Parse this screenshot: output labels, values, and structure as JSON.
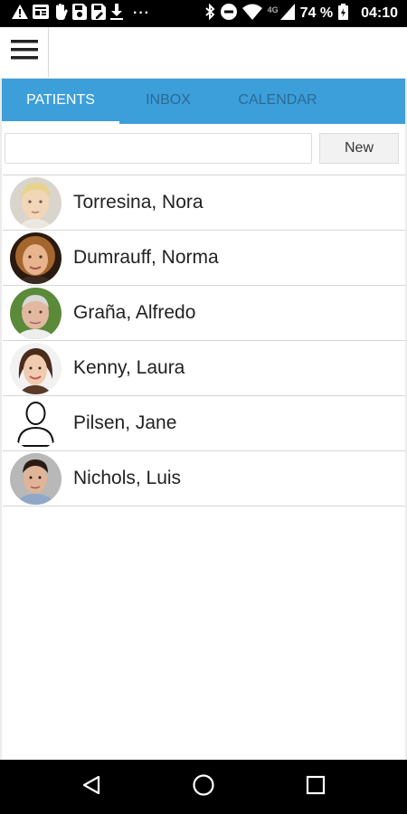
{
  "status_bar": {
    "battery_percent": "74 %",
    "time": "04:10",
    "network": "4G",
    "overflow": "···",
    "left_icons": [
      "alert-icon",
      "news-icon",
      "hand-icon",
      "save-icon",
      "save-edit-icon",
      "download-icon"
    ],
    "right_icons": [
      "bluetooth-icon",
      "do-not-disturb-icon",
      "wifi-icon",
      "signal-icon",
      "battery-icon"
    ]
  },
  "tabs": [
    {
      "label": "PATIENTS",
      "active": true
    },
    {
      "label": "INBOX",
      "active": false
    },
    {
      "label": "CALENDAR",
      "active": false
    }
  ],
  "search": {
    "value": "",
    "placeholder": ""
  },
  "new_button": {
    "label": "New"
  },
  "patients": [
    {
      "name": "Torresina, Nora",
      "avatar": "photo-child-blonde"
    },
    {
      "name": "Dumrauff, Norma",
      "avatar": "photo-woman-older"
    },
    {
      "name": "Graña, Alfredo",
      "avatar": "photo-man-older"
    },
    {
      "name": "Kenny, Laura",
      "avatar": "photo-woman-smiling"
    },
    {
      "name": "Pilsen, Jane",
      "avatar": "person-outline-icon"
    },
    {
      "name": "Nichols, Luis",
      "avatar": "photo-man-young"
    }
  ],
  "colors": {
    "tab_bar": "#3d9fd9",
    "tab_active": "#ffffff",
    "tab_inactive": "#2a6b94"
  },
  "nav_buttons": [
    "back-icon",
    "home-icon",
    "recents-icon"
  ]
}
